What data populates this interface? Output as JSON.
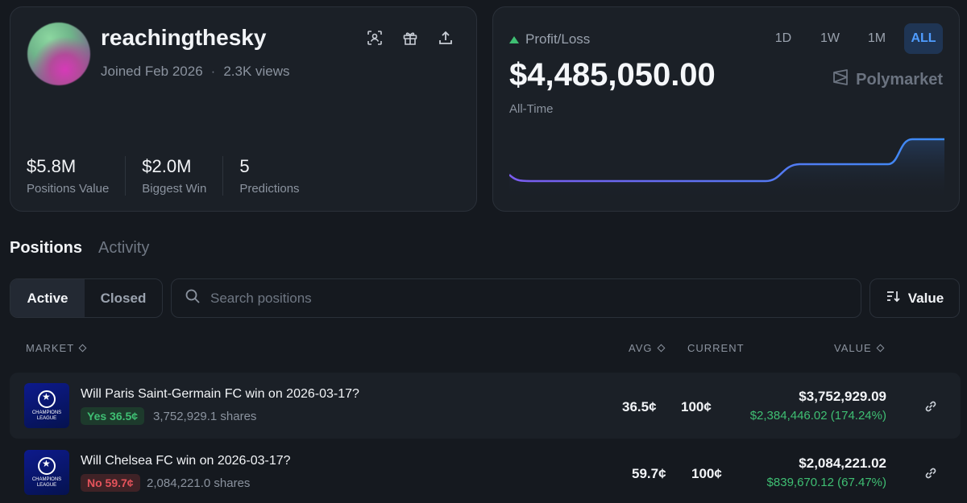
{
  "profile": {
    "username": "reachingthesky",
    "joined": "Joined Feb 2026",
    "separator": "·",
    "views": "2.3K views",
    "icons": [
      "scan-icon",
      "gift-icon",
      "share-icon"
    ],
    "stats": [
      {
        "value": "$5.8M",
        "label": "Positions Value"
      },
      {
        "value": "$2.0M",
        "label": "Biggest Win"
      },
      {
        "value": "5",
        "label": "Predictions"
      }
    ]
  },
  "pnl": {
    "label": "Profit/Loss",
    "value": "$4,485,050.00",
    "period": "All-Time",
    "brand": "Polymarket",
    "ranges": [
      "1D",
      "1W",
      "1M",
      "ALL"
    ],
    "active_range": "ALL",
    "line_color": "#7b5cf0",
    "line_color_end": "#3b8cf5"
  },
  "tabs": {
    "positions": "Positions",
    "activity": "Activity"
  },
  "filter": {
    "active": "Active",
    "closed": "Closed"
  },
  "search": {
    "placeholder": "Search positions"
  },
  "sort": {
    "label": "Value"
  },
  "table": {
    "headers": {
      "market": "MARKET",
      "avg": "AVG",
      "current": "CURRENT",
      "value": "VALUE"
    },
    "logo_text": "CHAMPIONS LEAGUE",
    "rows": [
      {
        "title": "Will Paris Saint-Germain FC win on 2026-03-17?",
        "outcome": "Yes 36.5¢",
        "outcome_type": "yes",
        "shares": "3,752,929.1 shares",
        "avg": "36.5¢",
        "current": "100¢",
        "value": "$3,752,929.09",
        "pnl": "$2,384,446.02 (174.24%)"
      },
      {
        "title": "Will Chelsea FC win on 2026-03-17?",
        "outcome": "No 59.7¢",
        "outcome_type": "no",
        "shares": "2,084,221.0 shares",
        "avg": "59.7¢",
        "current": "100¢",
        "value": "$2,084,221.02",
        "pnl": "$839,670.12 (67.47%)"
      }
    ]
  },
  "colors": {
    "accent": "#4f9cff",
    "positive": "#3fbf73",
    "negative": "#e5535b"
  }
}
